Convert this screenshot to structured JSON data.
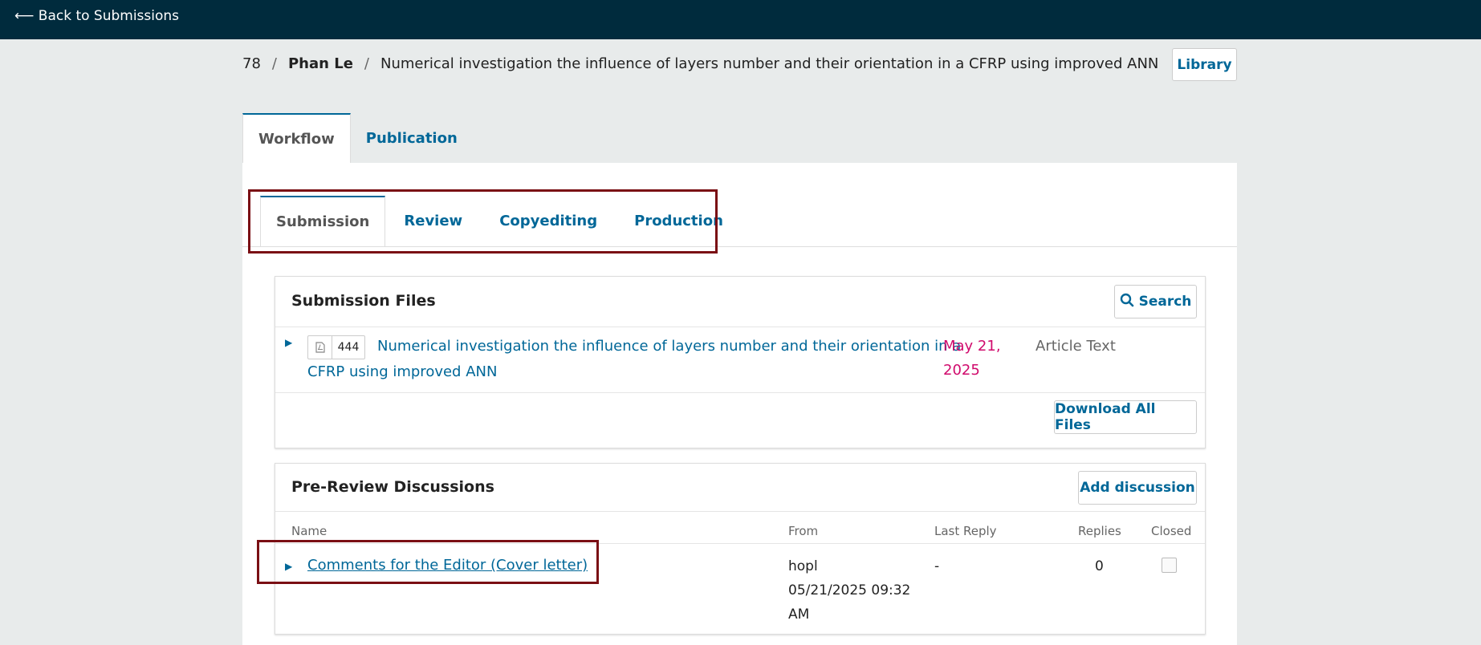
{
  "topbar": {
    "back_label": "⟵ Back to Submissions"
  },
  "breadcrumb": {
    "id": "78",
    "author": "Phan Le",
    "title": "Numerical investigation the influence of layers number and their orientation in a CFRP using improved ANN"
  },
  "header": {
    "library_label": "Library"
  },
  "main_tabs": [
    {
      "label": "Workflow",
      "active": true
    },
    {
      "label": "Publication",
      "active": false
    }
  ],
  "stage_tabs": [
    {
      "label": "Submission",
      "active": true
    },
    {
      "label": "Review",
      "active": false
    },
    {
      "label": "Copyediting",
      "active": false
    },
    {
      "label": "Production",
      "active": false
    }
  ],
  "submission_files": {
    "title": "Submission Files",
    "search_label": "Search",
    "files": [
      {
        "id": "444",
        "name_line1": "Numerical investigation the influence of layers number and their orientation in a",
        "name_line2": "CFRP using improved ANN",
        "date_line1": "May 21,",
        "date_line2": "2025",
        "type": "Article Text"
      }
    ],
    "download_all_label": "Download All Files"
  },
  "discussions": {
    "title": "Pre-Review Discussions",
    "add_label": "Add discussion",
    "columns": {
      "name": "Name",
      "from": "From",
      "last_reply": "Last Reply",
      "replies": "Replies",
      "closed": "Closed"
    },
    "rows": [
      {
        "name": "Comments for the Editor (Cover letter)",
        "from_user": "hopl",
        "from_date": "05/21/2025 09:32",
        "from_time_suffix": "AM",
        "last_reply": "-",
        "replies": "0",
        "closed": false
      }
    ]
  },
  "colors": {
    "topbar": "#002b3d",
    "link": "#006798",
    "date": "#d00a6c",
    "highlight": "#7a0f14"
  }
}
